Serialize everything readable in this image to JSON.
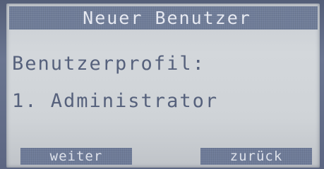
{
  "screen": {
    "title": "Neuer Benutzer",
    "profile_label": "Benutzerprofil:",
    "selected_profile": "1. Administrator"
  },
  "softkeys": {
    "left_label": "weiter",
    "right_label": "zurück"
  },
  "colors": {
    "lcd_background": "#cfd3d7",
    "lcd_text": "#56617c",
    "inverted_bar": "#6f7c98",
    "inverted_text": "#e6e9f1"
  }
}
